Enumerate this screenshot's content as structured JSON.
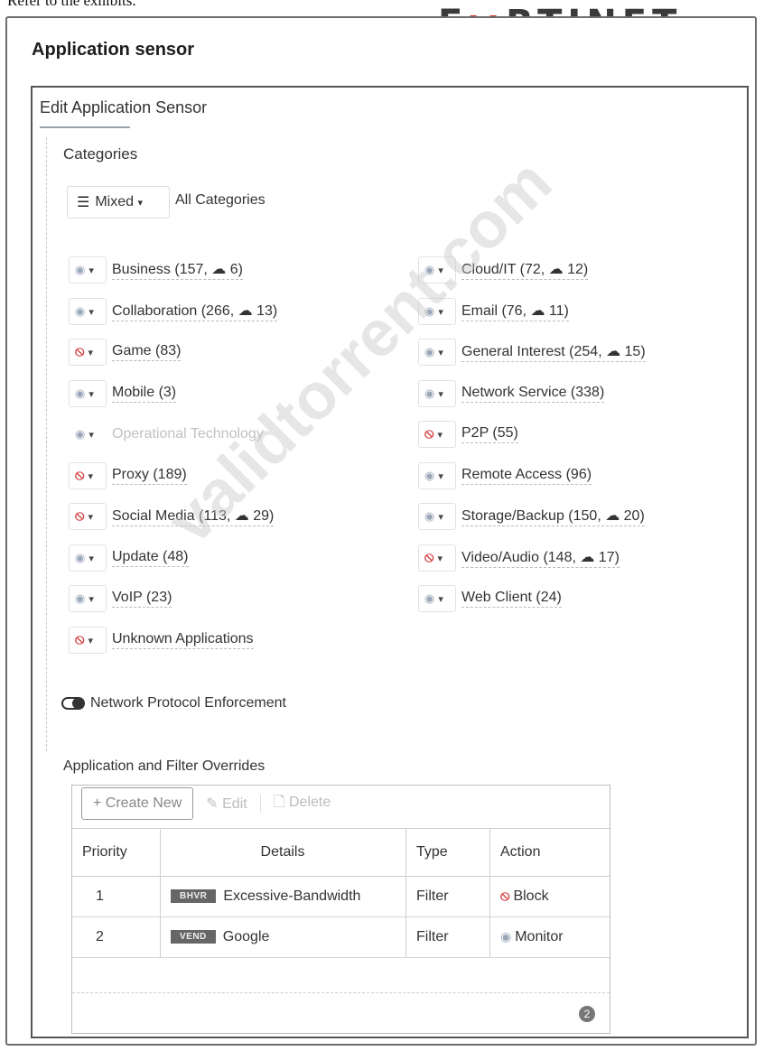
{
  "caption": "Refer to the exhibits.",
  "logo": {
    "pre": "F",
    "mid": "::",
    "post": "RTINET"
  },
  "page_title": "Application sensor",
  "panel_title": "Edit Application Sensor",
  "categories_label": "Categories",
  "mixed_button": {
    "label": "Mixed",
    "caret": "▾",
    "icon": "layers-icon"
  },
  "all_categories": "All Categories",
  "categories_left": [
    {
      "label": "Business (157, ☁ 6)",
      "action": "monitor"
    },
    {
      "label": "Collaboration (266, ☁ 13)",
      "action": "monitor"
    },
    {
      "label": "Game (83)",
      "action": "block"
    },
    {
      "label": "Mobile (3)",
      "action": "monitor"
    },
    {
      "label": "Operational Technology",
      "action": "disabled"
    },
    {
      "label": "Proxy (189)",
      "action": "block"
    },
    {
      "label": "Social Media (113, ☁ 29)",
      "action": "block"
    },
    {
      "label": "Update (48)",
      "action": "monitor"
    },
    {
      "label": "VoIP (23)",
      "action": "monitor"
    },
    {
      "label": "Unknown Applications",
      "action": "block"
    }
  ],
  "categories_right": [
    {
      "label": "Cloud/IT (72, ☁ 12)",
      "action": "monitor"
    },
    {
      "label": "Email (76, ☁ 11)",
      "action": "monitor"
    },
    {
      "label": "General Interest (254, ☁ 15)",
      "action": "monitor"
    },
    {
      "label": "Network Service (338)",
      "action": "monitor"
    },
    {
      "label": "P2P (55)",
      "action": "block"
    },
    {
      "label": "Remote Access (96)",
      "action": "monitor"
    },
    {
      "label": "Storage/Backup (150, ☁ 20)",
      "action": "monitor"
    },
    {
      "label": "Video/Audio (148, ☁ 17)",
      "action": "block"
    },
    {
      "label": "Web Client (24)",
      "action": "monitor"
    }
  ],
  "network_protocol_enforcement": "Network Protocol Enforcement",
  "overrides_label": "Application and Filter Overrides",
  "toolbar": {
    "create": "+ Create New",
    "edit": "✎ Edit",
    "delete": "🗋 Delete"
  },
  "table": {
    "headers": [
      "Priority",
      "Details",
      "Type",
      "Action"
    ],
    "rows": [
      {
        "priority": "1",
        "badge": "BHVR",
        "details": "Excessive-Bandwidth",
        "type": "Filter",
        "action": "Block",
        "action_icon": "block-icon"
      },
      {
        "priority": "2",
        "badge": "VEND",
        "details": "Google",
        "type": "Filter",
        "action": "Monitor",
        "action_icon": "monitor-eye-icon"
      }
    ],
    "count": "2"
  },
  "watermark": "validtorrent.com",
  "colors": {
    "block": "#d43d3d",
    "monitor": "#9aa7b8",
    "logo_red": "#d52b1e"
  }
}
